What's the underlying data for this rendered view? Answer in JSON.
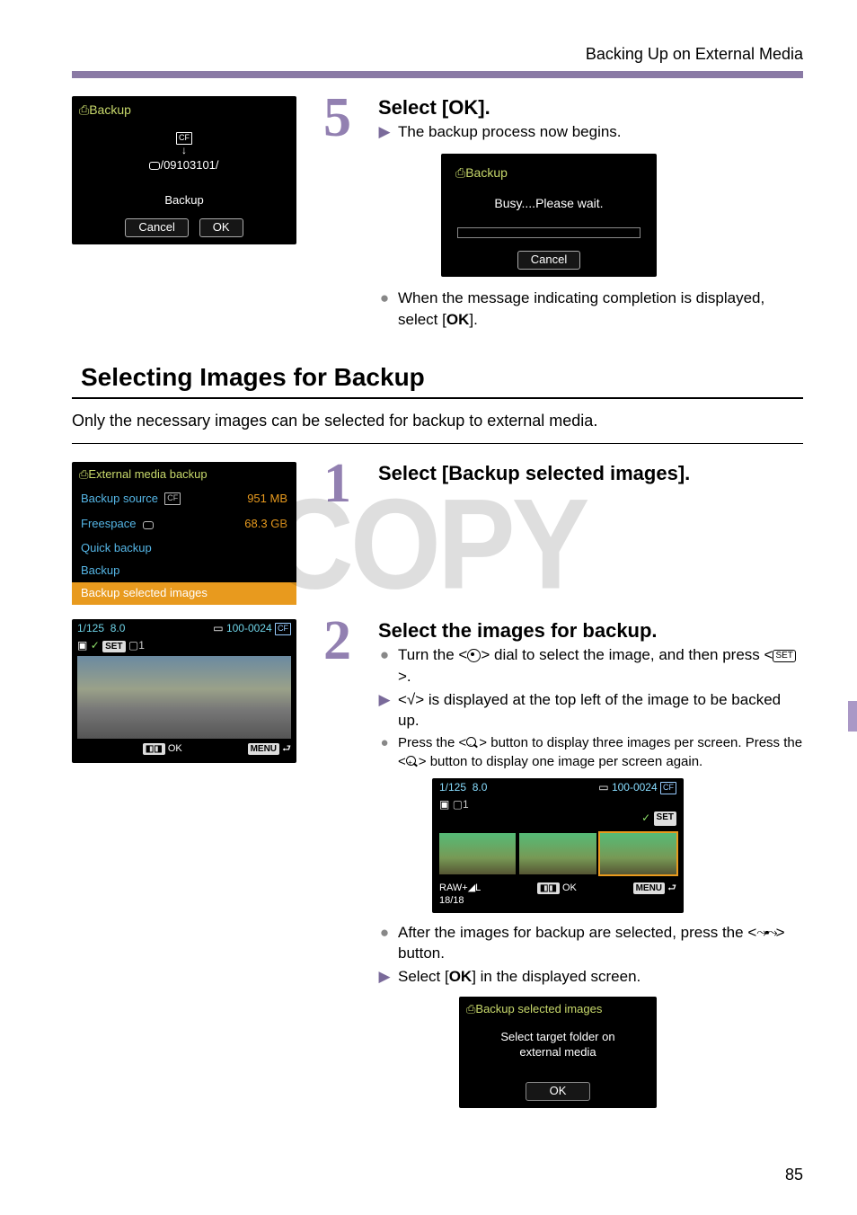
{
  "header": {
    "title": "Backing Up on External Media"
  },
  "step5": {
    "num": "5",
    "title": "Select [OK].",
    "line1": "The backup process now begins.",
    "line2_a": "When the message indicating completion is displayed, select [",
    "line2_b": "OK",
    "line2_c": "].",
    "lcd1": {
      "title": "Backup",
      "dest_label": "/09103101/",
      "action": "Backup",
      "cancel": "Cancel",
      "ok": "OK"
    },
    "lcd_busy": {
      "title": "Backup",
      "msg": "Busy....Please wait.",
      "cancel": "Cancel"
    }
  },
  "section": {
    "title": "Selecting Images for Backup",
    "intro": "Only the necessary images can be selected for backup to external media."
  },
  "step1": {
    "num": "1",
    "title": "Select [Backup selected images].",
    "lcd": {
      "title": "External media backup",
      "row1_lbl": "Backup source",
      "row1_val": "951 MB",
      "row2_lbl": "Freespace",
      "row2_val": "68.3 GB",
      "opt1": "Quick backup",
      "opt2": "Backup",
      "opt3": "Backup selected images"
    }
  },
  "step2": {
    "num": "2",
    "title": "Select the images for backup.",
    "b1_a": "Turn the <",
    "b1_b": "> dial to select the image, and then press <",
    "b1_c": ">.",
    "b2": "<√> is displayed at the top left of the image to be backed up.",
    "b3_a": "Press the <",
    "b3_b": "> button to display three images per screen. Press the <",
    "b3_c": "> button to display one image per screen again.",
    "b4_a": "After the images for backup are selected, press the <",
    "b4_b": "> button.",
    "b5_a": "Select [",
    "b5_b": "OK",
    "b5_c": "] in the displayed screen.",
    "lcd_img": {
      "shutter": "1/125",
      "ap": "8.0",
      "folder": "100-0024",
      "ok": "OK",
      "menu": "MENU",
      "set": "SET"
    },
    "lcd_thumbs": {
      "shutter": "1/125",
      "ap": "8.0",
      "folder": "100-0024",
      "fmt": "RAW+",
      "count": "18/18",
      "ok": "OK",
      "menu": "MENU",
      "set": "SET"
    },
    "lcd_bsi": {
      "title": "Backup selected images",
      "msg1": "Select target folder on",
      "msg2": "external media",
      "ok": "OK"
    }
  },
  "page_number": "85",
  "watermark": "COPY"
}
